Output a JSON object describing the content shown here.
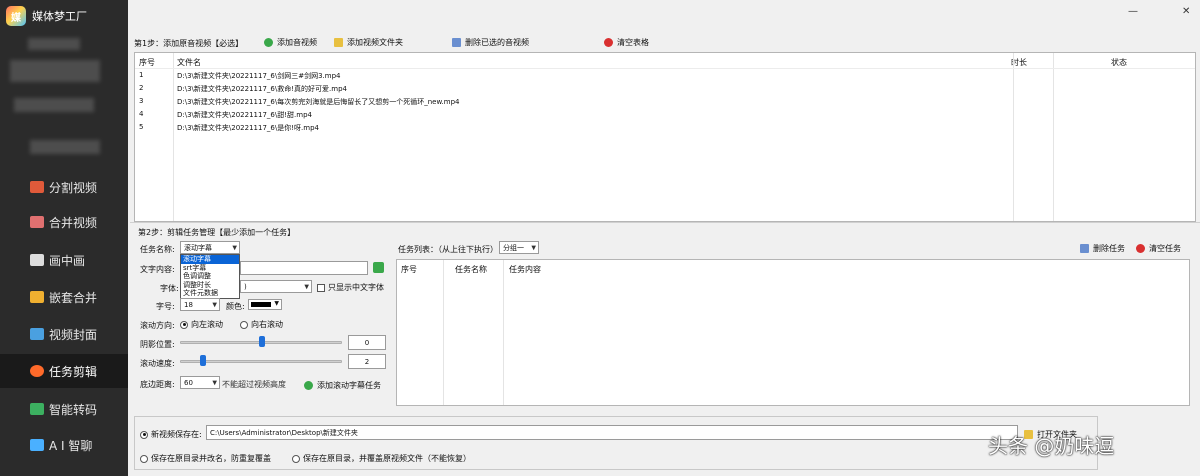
{
  "app": {
    "title": "媒体梦工厂",
    "logo_glyph": "媒"
  },
  "window": {
    "minimize": "—",
    "close": "✕"
  },
  "sidebar": {
    "items": [
      {
        "label": "分割视频",
        "icon": "split-icon",
        "color": "#e05a3a",
        "active": false
      },
      {
        "label": "合并视频",
        "icon": "merge-icon",
        "color": "#e07070",
        "active": false
      },
      {
        "label": "画中画",
        "icon": "pip-icon",
        "color": "#dddddd",
        "active": false
      },
      {
        "label": "嵌套合并",
        "icon": "nest-icon",
        "color": "#f0b030",
        "active": false
      },
      {
        "label": "视频封面",
        "icon": "cover-icon",
        "color": "#4aa0e0",
        "active": false
      },
      {
        "label": "任务剪辑",
        "icon": "task-icon",
        "color": "#ff6a2a",
        "active": true
      },
      {
        "label": "智能转码",
        "icon": "transcode-icon",
        "color": "#3cb060",
        "active": false
      },
      {
        "label": "A I 智聊",
        "icon": "ai-chat-icon",
        "color": "#4ab0ff",
        "active": false
      }
    ]
  },
  "step1": {
    "label": "第1步：添加原音视频【必选】",
    "buttons": {
      "add_video": "添加音视频",
      "add_folder": "添加视频文件夹",
      "delete_selected": "删除已选的音视频",
      "clear_table": "清空表格"
    },
    "columns": {
      "no": "序号",
      "name": "文件名",
      "duration": "时长",
      "status": "状态"
    },
    "rows": [
      {
        "no": "1",
        "name": "D:\\3\\新建文件夹\\20221117_6\\剑网三#剑网3.mp4"
      },
      {
        "no": "2",
        "name": "D:\\3\\新建文件夹\\20221117_6\\救命!真的好可爱.mp4"
      },
      {
        "no": "3",
        "name": "D:\\3\\新建文件夹\\20221117_6\\每次剪完刘海就是后悔留长了又想剪一个死循环_new.mp4"
      },
      {
        "no": "4",
        "name": "D:\\3\\新建文件夹\\20221117_6\\甜!甜.mp4"
      },
      {
        "no": "5",
        "name": "D:\\3\\新建文件夹\\20221117_6\\是你!呀.mp4"
      }
    ]
  },
  "step2": {
    "label": "第2步：剪辑任务管理【最少添加一个任务】",
    "task_name_label": "任务名称:",
    "task_name_value": "滚动字幕",
    "dropdown_options": [
      "滚动字幕",
      "srt字幕",
      "色调调整",
      "调整时长",
      "文件元数据"
    ],
    "text_content_label": "文字内容:",
    "font_label": "字体:",
    "font_value": ")",
    "only_chinese_label": "只显示中文字体",
    "font_size_label": "字号:",
    "font_size_value": "18",
    "color_label": "颜色:",
    "scroll_direction_label": "滚动方向:",
    "scroll_left": "向左滚动",
    "scroll_right": "向右滚动",
    "shadow_label": "阴影位置:",
    "shadow_value": "0",
    "speed_label": "滚动速度:",
    "speed_value": "2",
    "bottom_label": "底边距离:",
    "bottom_value": "60",
    "bottom_hint": "不能超过视频高度",
    "add_task_button": "添加滚动字幕任务"
  },
  "task_list": {
    "label": "任务列表：（从上往下执行）",
    "group_value": "分组一",
    "delete_task": "删除任务",
    "clear_tasks": "清空任务",
    "columns": {
      "no": "序号",
      "name": "任务名称",
      "content": "任务内容"
    }
  },
  "save": {
    "new_save_label": "新视频保存在:",
    "path": "C:\\Users\\Administrator\\Desktop\\新建文件夹",
    "open_folder": "打开文件夹",
    "same_dir_rename": "保存在原目录并改名，防重复覆盖",
    "same_dir_overwrite": "保存在原目录，并覆盖原视频文件（不能恢复）"
  },
  "watermark": "头条 @奶味逗"
}
